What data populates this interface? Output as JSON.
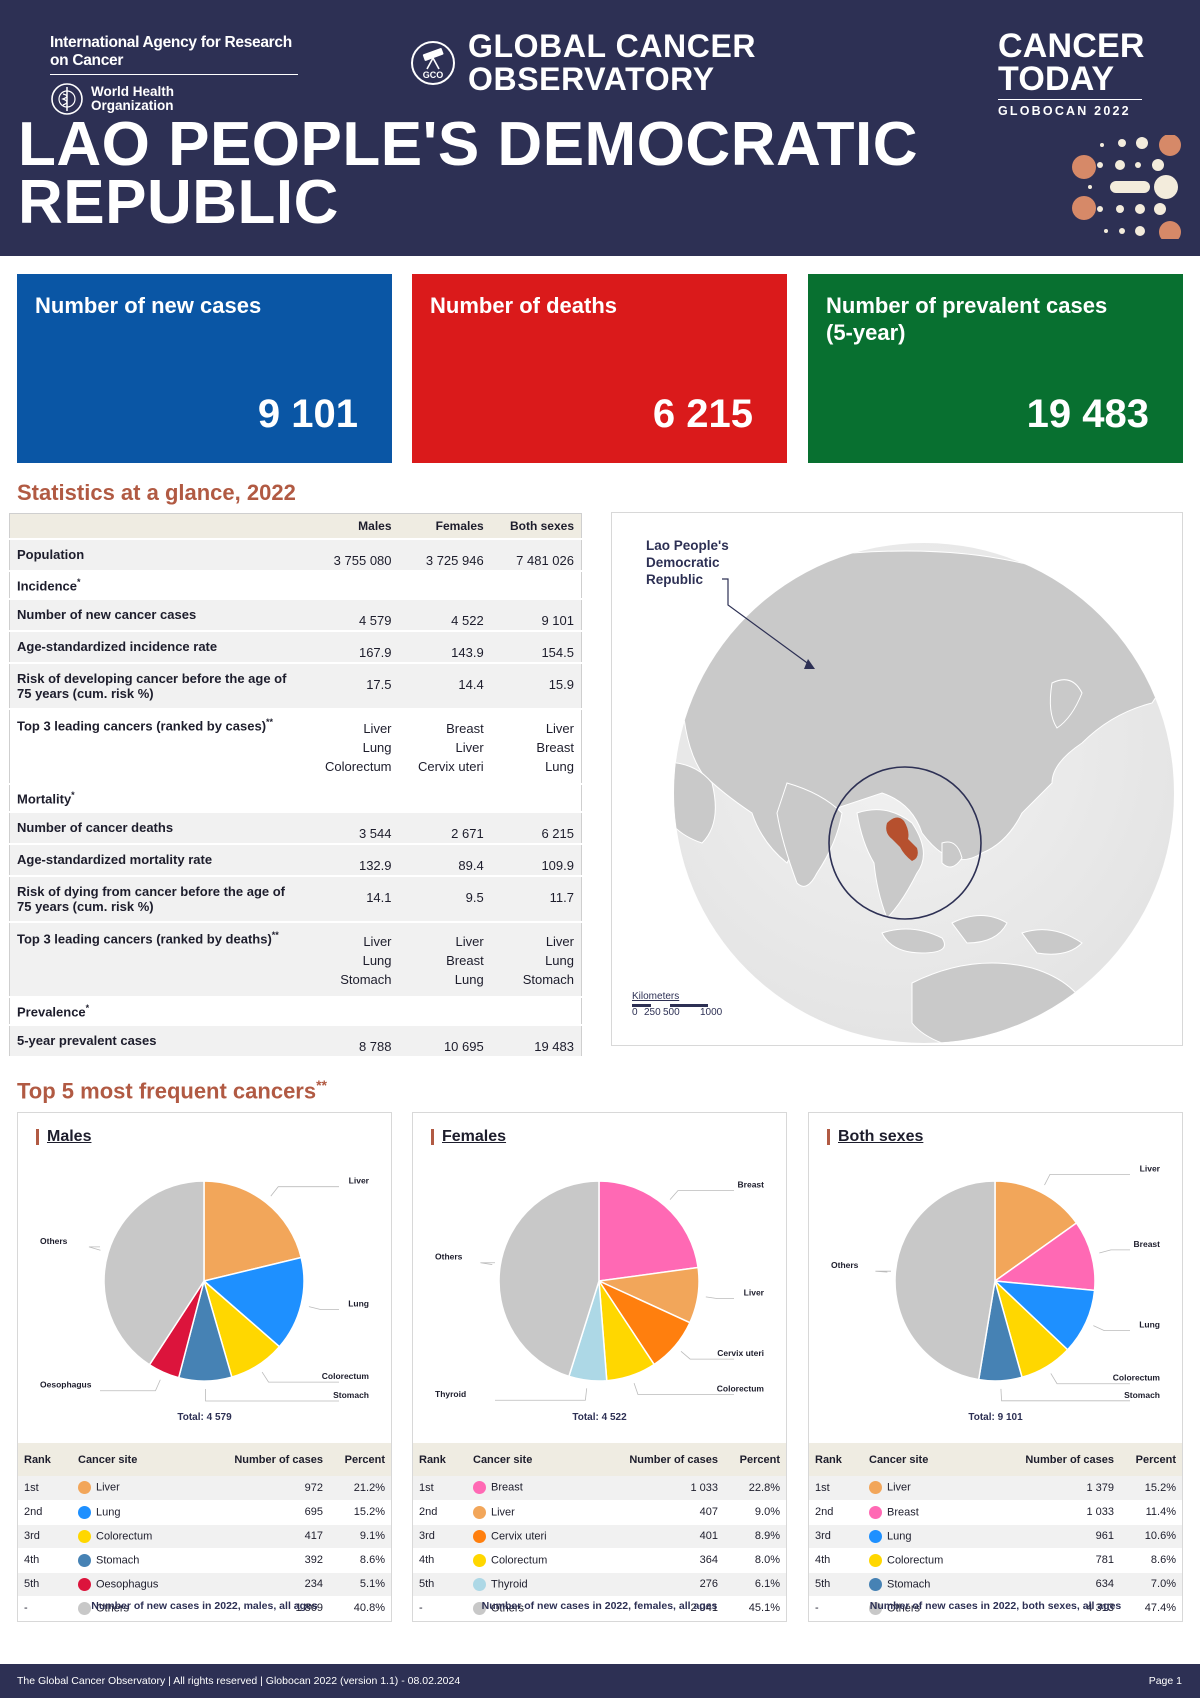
{
  "header": {
    "iarc": "International Agency for Research on Cancer",
    "who": [
      "World Health",
      "Organization"
    ],
    "gco_title": [
      "GLOBAL CANCER",
      "OBSERVATORY"
    ],
    "ct_title": [
      "CANCER",
      "TODAY"
    ],
    "ct_sub": "GLOBOCAN 2022",
    "country_lines": [
      "LAO PEOPLE'S DEMOCRATIC",
      "REPUBLIC"
    ]
  },
  "cards": [
    {
      "label": "Number of new cases",
      "value": "9 101",
      "color": "#0a56a5"
    },
    {
      "label": "Number of deaths",
      "value": "6 215",
      "color": "#da1a1b"
    },
    {
      "label": "Number of prevalent cases (5-year)",
      "value": "19 483",
      "color": "#087030"
    }
  ],
  "glance": {
    "title": "Statistics at a glance, 2022",
    "columns": [
      "Males",
      "Females",
      "Both sexes"
    ],
    "rows": [
      {
        "label": "Population",
        "values": [
          "3 755 080",
          "3 725 946",
          "7 481 026"
        ],
        "style": "shade"
      },
      {
        "label": "Incidence",
        "section": true
      },
      {
        "label": "Number of new cancer cases",
        "values": [
          "4 579",
          "4 522",
          "9 101"
        ],
        "style": "shade"
      },
      {
        "label": "Age-standardized incidence rate",
        "values": [
          "167.9",
          "143.9",
          "154.5"
        ],
        "style": "shade"
      },
      {
        "label": "Risk of developing cancer before the age of 75 years (cum. risk %)",
        "values": [
          "17.5",
          "14.4",
          "15.9"
        ],
        "style": "shade"
      },
      {
        "label": "Top 3 leading cancers (ranked by cases)",
        "sup": "**",
        "values": [
          "Liver\nLung\nColorectum",
          "Breast\nLiver\nCervix uteri",
          "Liver\nBreast\nLung"
        ],
        "style": "white"
      },
      {
        "label": "Mortality",
        "section": true
      },
      {
        "label": "Number of cancer deaths",
        "values": [
          "3 544",
          "2 671",
          "6 215"
        ],
        "style": "shade"
      },
      {
        "label": "Age-standardized mortality rate",
        "values": [
          "132.9",
          "89.4",
          "109.9"
        ],
        "style": "shade"
      },
      {
        "label": "Risk of dying from cancer before the age of 75 years (cum. risk %)",
        "values": [
          "14.1",
          "9.5",
          "11.7"
        ],
        "style": "shade"
      },
      {
        "label": "Top 3 leading cancers (ranked by deaths)",
        "sup": "**",
        "values": [
          "Liver\nLung\nStomach",
          "Liver\nBreast\nLung",
          "Liver\nLung\nStomach"
        ],
        "style": "shade"
      },
      {
        "label": "Prevalence",
        "section": true
      },
      {
        "label": "5-year prevalent cases",
        "values": [
          "8 788",
          "10 695",
          "19 483"
        ],
        "style": "shade"
      }
    ]
  },
  "map": {
    "label": [
      "Lao People's",
      "Democratic",
      "Republic"
    ],
    "scale_title": "Kilometers",
    "scale_ticks": [
      "0",
      "250",
      "500",
      "1000"
    ]
  },
  "top5_title": "Top 5 most frequent cancers",
  "panels": [
    {
      "title": "Males",
      "total": "Total: 4 579",
      "caption": "Number of new cases in 2022, males, all ages",
      "headers": [
        "Rank",
        "Cancer site",
        "Number of cases",
        "Percent"
      ],
      "rows": [
        {
          "rank": "1st",
          "site": "Liver",
          "cases": "972",
          "pct": "21.2%",
          "color": "#f2a65a"
        },
        {
          "rank": "2nd",
          "site": "Lung",
          "cases": "695",
          "pct": "15.2%",
          "color": "#1e90ff"
        },
        {
          "rank": "3rd",
          "site": "Colorectum",
          "cases": "417",
          "pct": "9.1%",
          "color": "#ffd700"
        },
        {
          "rank": "4th",
          "site": "Stomach",
          "cases": "392",
          "pct": "8.6%",
          "color": "#4682b4"
        },
        {
          "rank": "5th",
          "site": "Oesophagus",
          "cases": "234",
          "pct": "5.1%",
          "color": "#dc143c"
        },
        {
          "rank": "-",
          "site": "Others",
          "cases": "1 869",
          "pct": "40.8%",
          "color": "#c8c8c8"
        }
      ]
    },
    {
      "title": "Females",
      "total": "Total: 4 522",
      "caption": "Number of new cases in 2022, females, all ages",
      "headers": [
        "Rank",
        "Cancer site",
        "Number of cases",
        "Percent"
      ],
      "rows": [
        {
          "rank": "1st",
          "site": "Breast",
          "cases": "1 033",
          "pct": "22.8%",
          "color": "#ff69b4"
        },
        {
          "rank": "2nd",
          "site": "Liver",
          "cases": "407",
          "pct": "9.0%",
          "color": "#f2a65a"
        },
        {
          "rank": "3rd",
          "site": "Cervix uteri",
          "cases": "401",
          "pct": "8.9%",
          "color": "#ff7f0e"
        },
        {
          "rank": "4th",
          "site": "Colorectum",
          "cases": "364",
          "pct": "8.0%",
          "color": "#ffd700"
        },
        {
          "rank": "5th",
          "site": "Thyroid",
          "cases": "276",
          "pct": "6.1%",
          "color": "#add8e6"
        },
        {
          "rank": "-",
          "site": "Others",
          "cases": "2 041",
          "pct": "45.1%",
          "color": "#c8c8c8"
        }
      ]
    },
    {
      "title": "Both sexes",
      "total": "Total: 9 101",
      "caption": "Number of new cases in 2022, both sexes, all ages",
      "headers": [
        "Rank",
        "Cancer site",
        "Number of cases",
        "Percent"
      ],
      "rows": [
        {
          "rank": "1st",
          "site": "Liver",
          "cases": "1 379",
          "pct": "15.2%",
          "color": "#f2a65a"
        },
        {
          "rank": "2nd",
          "site": "Breast",
          "cases": "1 033",
          "pct": "11.4%",
          "color": "#ff69b4"
        },
        {
          "rank": "3rd",
          "site": "Lung",
          "cases": "961",
          "pct": "10.6%",
          "color": "#1e90ff"
        },
        {
          "rank": "4th",
          "site": "Colorectum",
          "cases": "781",
          "pct": "8.6%",
          "color": "#ffd700"
        },
        {
          "rank": "5th",
          "site": "Stomach",
          "cases": "634",
          "pct": "7.0%",
          "color": "#4682b4"
        },
        {
          "rank": "-",
          "site": "Others",
          "cases": "4 313",
          "pct": "47.4%",
          "color": "#c8c8c8"
        }
      ]
    }
  ],
  "footer": {
    "left": "The Global Cancer Observatory | All rights reserved | Globocan 2022 (version 1.1) - 08.02.2024",
    "right": "Page 1"
  }
}
